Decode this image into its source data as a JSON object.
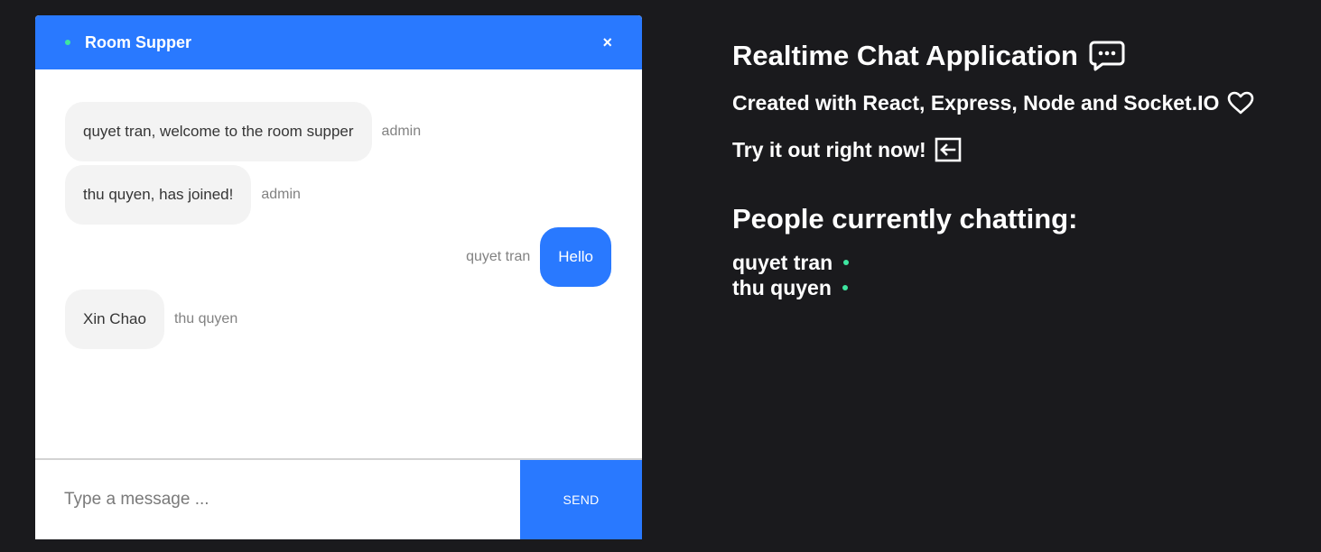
{
  "chat": {
    "room_name": "Room Supper",
    "close_symbol": "×",
    "messages": [
      {
        "text": "quyet tran, welcome to the room supper",
        "sender": "admin",
        "side": "left"
      },
      {
        "text": "thu quyen, has joined!",
        "sender": "admin",
        "side": "left"
      },
      {
        "text": "Hello",
        "sender": "quyet tran",
        "side": "right"
      },
      {
        "text": "Xin Chao",
        "sender": "thu quyen",
        "side": "left"
      }
    ],
    "input": {
      "value": "",
      "placeholder": "Type a message ..."
    },
    "send_label": "SEND"
  },
  "info": {
    "title": "Realtime Chat Application",
    "title_icon": "chat-bubble-icon",
    "subtitle": "Created with React, Express, Node and Socket.IO",
    "subtitle_icon": "heart-icon",
    "try_text": "Try it out right now!",
    "try_icon": "arrow-left-box-icon",
    "people_title": "People currently chatting:",
    "people": [
      "quyet tran",
      "thu quyen"
    ]
  },
  "colors": {
    "background": "#1a1a1d",
    "accent": "#2979ff",
    "online": "#3ee6a0",
    "bubble_received": "#f3f3f3"
  }
}
